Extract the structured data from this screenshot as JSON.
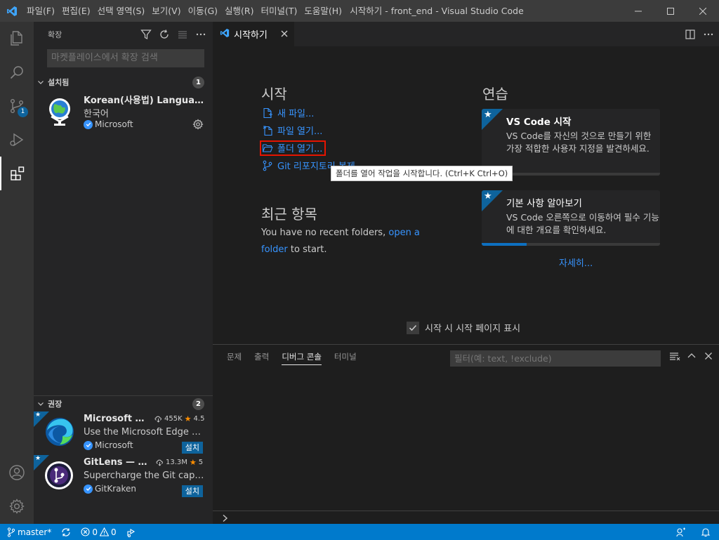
{
  "app": {
    "title": "시작하기 - front_end - Visual Studio Code",
    "menu": [
      "파일(F)",
      "편집(E)",
      "선택 영역(S)",
      "보기(V)",
      "이동(G)",
      "실행(R)",
      "터미널(T)",
      "도움말(H)"
    ]
  },
  "activity_bar": {
    "scm_badge": "1"
  },
  "sidebar": {
    "header": "확장",
    "search_placeholder": "마켓플레이스에서 확장 검색",
    "installed": {
      "title": "설치됨",
      "count": "1",
      "items": [
        {
          "name": "Korean(사용법) Language ...",
          "description": "한국어",
          "publisher": "Microsoft"
        }
      ]
    },
    "recommended": {
      "title": "권장",
      "count": "2",
      "items": [
        {
          "name": "Microsoft Ed...",
          "downloads": "455K",
          "rating": "4.5",
          "description": "Use the Microsoft Edge Tool...",
          "publisher": "Microsoft",
          "install_label": "설치"
        },
        {
          "name": "GitLens — Git...",
          "downloads": "13.3M",
          "rating": "5",
          "description": "Supercharge the Git capabili...",
          "publisher": "GitKraken",
          "install_label": "설치"
        }
      ]
    }
  },
  "editor": {
    "tab_label": "시작하기",
    "start": {
      "title": "시작",
      "links": [
        "새 파일...",
        "파일 열기...",
        "폴더 열기...",
        "Git 리포지토리 복제..."
      ]
    },
    "recent": {
      "title": "최근 항목",
      "text_before": "You have no recent folders,",
      "link": "open a folder",
      "text_after": "to start."
    },
    "walkthroughs": {
      "title": "연습",
      "cards": [
        {
          "title": "VS Code 시작",
          "description": "VS Code를 자신의 것으로 만들기 위한 가장 적합한 사용자 지정을 발견하세요.",
          "progress": 0
        },
        {
          "title": "기본 사항 알아보기",
          "description": "VS Code 오른쪽으로 이동하여 필수 기능에 대한 개요를 확인하세요.",
          "progress": 0.25
        }
      ],
      "more": "자세히..."
    },
    "startup_checkbox": "시작 시 시작 페이지 표시",
    "tooltip": "폴더를 열어 작업을 시작합니다. (Ctrl+K Ctrl+O)"
  },
  "panel": {
    "tabs": [
      "문제",
      "출력",
      "디버그 콘솔",
      "터미널"
    ],
    "active_tab": "디버그 콘솔",
    "filter_placeholder": "필터(예: text, !exclude)"
  },
  "status_bar": {
    "branch": "master*",
    "errors": "0",
    "warnings": "0"
  },
  "colors": {
    "accent": "#007acc",
    "link": "#3794ff",
    "highlight_box": "#e51400"
  }
}
